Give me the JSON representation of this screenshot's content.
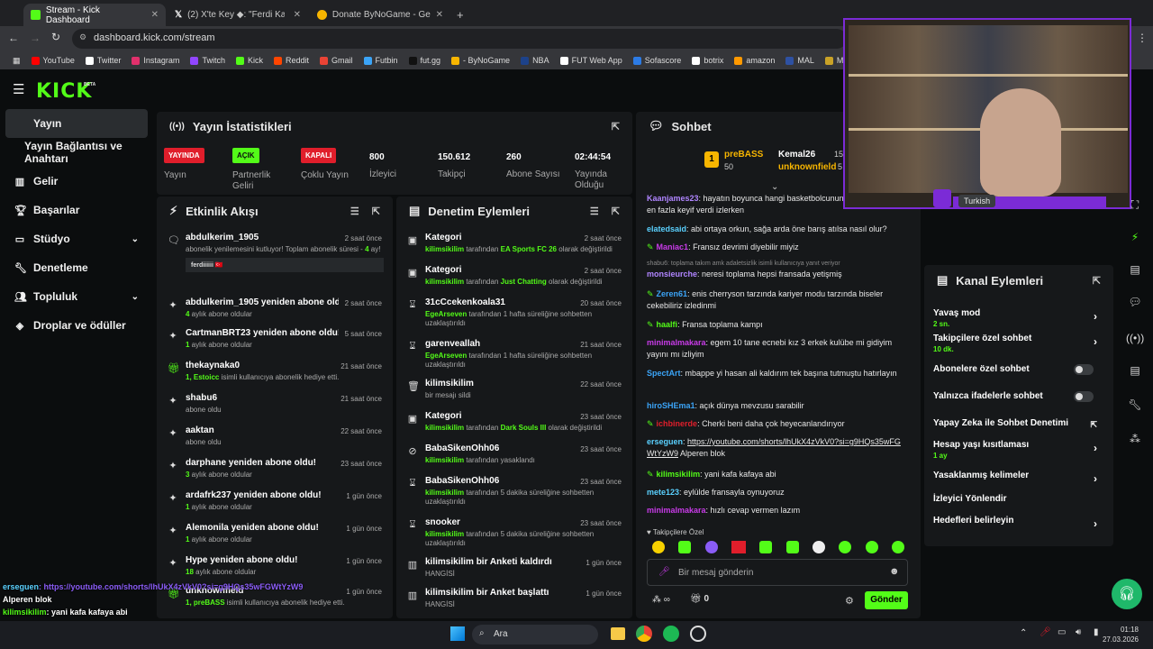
{
  "browser": {
    "tabs": [
      {
        "title": "Stream - Kick Dashboard",
        "active": true,
        "icon": "kick-favicon"
      },
      {
        "title": "(2) X'te Key ◆: \"Ferdi Kadıoğlu",
        "active": false,
        "icon": "x-favicon"
      },
      {
        "title": "Donate ByNoGame - Gelen/Gid",
        "active": false,
        "icon": "bynogame-favicon"
      }
    ],
    "url": "dashboard.kick.com/stream",
    "bookmarks": [
      {
        "label": "YouTube",
        "color": "#ff0000"
      },
      {
        "label": "Twitter",
        "color": "#ffffff"
      },
      {
        "label": "Instagram",
        "color": "#e1306c"
      },
      {
        "label": "Twitch",
        "color": "#9146ff"
      },
      {
        "label": "Kick",
        "color": "#53fc18"
      },
      {
        "label": "Reddit",
        "color": "#ff4500"
      },
      {
        "label": "Gmail",
        "color": "#ea4335"
      },
      {
        "label": "Futbin",
        "color": "#3ba4f7"
      },
      {
        "label": "fut.gg",
        "color": "#111111"
      },
      {
        "label": "- ByNoGame",
        "color": "#f7b500"
      },
      {
        "label": "NBA",
        "color": "#1d428a"
      },
      {
        "label": "FUT Web App",
        "color": "#ffffff"
      },
      {
        "label": "Sofascore",
        "color": "#2c7be5"
      },
      {
        "label": "botrix",
        "color": "#ffffff"
      },
      {
        "label": "amazon",
        "color": "#ff9900"
      },
      {
        "label": "MAL",
        "color": "#2e51a2"
      },
      {
        "label": "MetaTFT",
        "color": "#c9a227"
      }
    ]
  },
  "header": {
    "logo": "KICK",
    "beta": "BETA"
  },
  "sidebar": {
    "items": [
      {
        "label": "Yayın",
        "icon": "broadcast-icon"
      },
      {
        "label": "Yayın Bağlantısı ve Anahtarı",
        "icon": ""
      },
      {
        "label": "Gelir",
        "icon": "chart-icon"
      },
      {
        "label": "Başarılar",
        "icon": "trophy-icon"
      },
      {
        "label": "Stüdyo",
        "icon": "studio-icon"
      },
      {
        "label": "Denetleme",
        "icon": "wrench-icon"
      },
      {
        "label": "Topluluk",
        "icon": "community-icon"
      },
      {
        "label": "Droplar ve ödüller",
        "icon": "drops-icon"
      }
    ]
  },
  "stats": {
    "title": "Yayın İstatistikleri",
    "items": [
      {
        "badge": "YAYINDA",
        "badge_color": "#e01e2b",
        "label": "Yayın"
      },
      {
        "badge": "AÇIK",
        "badge_color": "#53fc18",
        "label": "Partnerlik Geliri"
      },
      {
        "badge": "KAPALI",
        "badge_color": "#e01e2b",
        "label": "Çoklu Yayın"
      },
      {
        "value": "800",
        "label": "İzleyici"
      },
      {
        "value": "150.612",
        "label": "Takipçi"
      },
      {
        "value": "260",
        "label": "Abone Sayısı"
      },
      {
        "value": "02:44:54",
        "label": "Yayında Olduğu"
      }
    ]
  },
  "activity": {
    "title": "Etkinlik Akışı",
    "rows": [
      {
        "title": "abdulkerim_1905",
        "time": "2 saat önce",
        "sub_pre": "abonelik yenilemesini kutluyor! Toplam abonelik süresi - ",
        "sub_hl": "4",
        "sub_post": " ay!",
        "quote": "ferdiiiiii 🇹🇷"
      },
      {
        "title": "abdulkerim_1905 yeniden abone oldu!",
        "time": "2 saat önce",
        "sub_hl": "4",
        "sub_post": " aylık abone oldular"
      },
      {
        "title": "CartmanBRT23 yeniden abone oldu!",
        "time": "5 saat önce",
        "sub_hl": "1",
        "sub_post": " aylık abone oldular"
      },
      {
        "title": "thekaynaka0",
        "time": "21 saat önce",
        "sub_hl": "1, Estoicc",
        "sub_post": " isimli kullanıcıya abonelik hediye etti."
      },
      {
        "title": "shabu6",
        "time": "21 saat önce",
        "sub_post": "abone oldu"
      },
      {
        "title": "aaktan",
        "time": "22 saat önce",
        "sub_post": "abone oldu"
      },
      {
        "title": "darphane yeniden abone oldu!",
        "time": "23 saat önce",
        "sub_hl": "3",
        "sub_post": " aylık abone oldular"
      },
      {
        "title": "ardafrk237 yeniden abone oldu!",
        "time": "1 gün önce",
        "sub_hl": "1",
        "sub_post": " aylık abone oldular"
      },
      {
        "title": "Alemonila yeniden abone oldu!",
        "time": "1 gün önce",
        "sub_hl": "1",
        "sub_post": " aylık abone oldular"
      },
      {
        "title": "Hype yeniden abone oldu!",
        "time": "1 gün önce",
        "sub_hl": "18",
        "sub_post": " aylık abone oldular"
      },
      {
        "title": "unknownfield",
        "time": "1 gün önce",
        "sub_hl": "1, preBASS",
        "sub_post": " isimli kullanıcıya abonelik hediye etti."
      }
    ]
  },
  "moderation": {
    "title": "Denetim Eylemleri",
    "rows": [
      {
        "title": "Kategori",
        "time": "2 saat önce",
        "icon": "category-icon",
        "who": "kilimsikilim",
        "mid": " tarafından ",
        "target": "EA Sports FC 26",
        "end": " olarak değiştirildi"
      },
      {
        "title": "Kategori",
        "time": "2 saat önce",
        "icon": "category-icon",
        "who": "kilimsikilim",
        "mid": " tarafından ",
        "target": "Just Chatting",
        "end": " olarak değiştirildi"
      },
      {
        "title": "31cCcekenkoala31",
        "time": "20 saat önce",
        "icon": "hourglass-icon",
        "who": "EgeArseven",
        "mid": " tarafından 1 hafta süreliğine sohbetten uzaklaştırıldı",
        "target": "",
        "end": ""
      },
      {
        "title": "garenveallah",
        "time": "21 saat önce",
        "icon": "hourglass-icon",
        "who": "EgeArseven",
        "mid": " tarafından 1 hafta süreliğine sohbetten uzaklaştırıldı",
        "target": "",
        "end": ""
      },
      {
        "title": "kilimsikilim",
        "time": "22 saat önce",
        "icon": "trash-icon",
        "who": "",
        "mid": "bir mesajı sildi",
        "target": "",
        "end": ""
      },
      {
        "title": "Kategori",
        "time": "23 saat önce",
        "icon": "category-icon",
        "who": "kilimsikilim",
        "mid": " tarafından ",
        "target": "Dark Souls III",
        "end": " olarak değiştirildi"
      },
      {
        "title": "BabaSikenOhh06",
        "time": "23 saat önce",
        "icon": "ban-icon",
        "who": "kilimsikilim",
        "mid": " tarafından yasaklandı",
        "target": "",
        "end": ""
      },
      {
        "title": "BabaSikenOhh06",
        "time": "23 saat önce",
        "icon": "hourglass-icon",
        "who": "kilimsikilim",
        "mid": " tarafından 5 dakika süreliğine sohbetten uzaklaştırıldı",
        "target": "",
        "end": ""
      },
      {
        "title": "snooker",
        "time": "23 saat önce",
        "icon": "hourglass-icon",
        "who": "kilimsikilim",
        "mid": " tarafından 5 dakika süreliğine sohbetten uzaklaştırıldı",
        "target": "",
        "end": ""
      },
      {
        "title": "kilimsikilim bir Anketi kaldırdı",
        "time": "1 gün önce",
        "icon": "poll-icon",
        "who": "",
        "mid": "HANGİSİ",
        "target": "",
        "end": ""
      },
      {
        "title": "kilimsikilim bir Anket başlattı",
        "time": "1 gün önce",
        "icon": "poll-icon",
        "who": "",
        "mid": "HANGİSİ",
        "target": "",
        "end": ""
      }
    ]
  },
  "chat": {
    "title": "Sohbet",
    "leaderboard": [
      {
        "rank": "1",
        "name": "preBASS",
        "count": "50"
      },
      {
        "name": "Kemal26",
        "count": "15"
      },
      {
        "name": "unknownfield",
        "count": "5"
      }
    ],
    "messages": [
      {
        "user": "Kaanjames23",
        "color": "#b085ff",
        "text": ": hayatın boyunca hangi basketbolcunun hangi yılı sana en fazla keyif verdi izlerken"
      },
      {
        "user": "elatedsaid",
        "color": "#5ad1ff",
        "text": ": abi ortaya orkun, sağa arda öne barış atılsa nasıl olur?"
      },
      {
        "user": "Maniac1",
        "color": "#c83be8",
        "text": ": Fransız devrimi diyebilir miyiz",
        "badge": true
      },
      {
        "reply": "shabu6: toplama takım amk adaletsizlik isimli kullanıcıya yanıt veriyor",
        "user": "monsieurche",
        "color": "#b085ff",
        "text": ": neresi toplama hepsi fransada yetişmiş"
      },
      {
        "user": "Zeren61",
        "color": "#3ba4f7",
        "text": ": enis cherryson tarzında kariyer modu tarzında biseler cekebiliriz izledinmi",
        "badge": true
      },
      {
        "user": "haalfi",
        "color": "#53fc18",
        "text": ": Fransa toplama kampı",
        "badge": true
      },
      {
        "user": "minimalmakara",
        "color": "#c83be8",
        "text": ": egem 10 tane ecnebi kız 3 erkek kulübe mi gidiyim yayını mı izliyim"
      },
      {
        "user": "SpectArt",
        "color": "#3ba4f7",
        "text": ": mbappe yi hasan ali kaldırım tek başına tutmuştu hatırlayın"
      },
      {
        "user": "hiroSHEma1",
        "color": "#3ba4f7",
        "text": ": açık dünya mevzusu sarabilir"
      },
      {
        "user": "ichbinerde",
        "color": "#e01e2b",
        "text": ": Cherki beni daha çok heyecanlandırıyor",
        "badge": true
      },
      {
        "user": "erseguen",
        "color": "#5ad1ff",
        "text": ": ",
        "link": "https://youtube.com/shorts/lhUkX4zVkV0?si=g9HQs35wFGWtYzW9",
        "after": " Alperen blok"
      },
      {
        "user": "kilimsikilim",
        "color": "#53fc18",
        "text": ": yani kafa kafaya abi",
        "badge": true
      },
      {
        "user": "mete123",
        "color": "#5ad1ff",
        "text": ": eylülde fransayla oynuyoruz"
      },
      {
        "user": "minimalmakara",
        "color": "#c83be8",
        "text": ": hızlı cevap vermen lazım"
      }
    ],
    "mode_label": "Takipçilere Özel",
    "input_placeholder": "Bir mesaj gönderin",
    "points": "0",
    "send_label": "Gönder"
  },
  "streamer_overlay": {
    "language_tag": "Turkish"
  },
  "channel_actions": {
    "title": "Kanal Eylemleri",
    "items": [
      {
        "label": "Yavaş mod",
        "sub": "2 sn.",
        "kind": "arrow"
      },
      {
        "label": "Takipçilere özel sohbet",
        "sub": "10 dk.",
        "kind": "arrow"
      },
      {
        "label": "Abonelere özel sohbet",
        "kind": "toggle"
      },
      {
        "label": "Yalnızca ifadelerle sohbet",
        "kind": "toggle"
      },
      {
        "label": "Yapay Zeka ile Sohbet Denetimi",
        "kind": "external"
      },
      {
        "label": "Hesap yaşı kısıtlaması",
        "sub": "1 ay",
        "kind": "arrow"
      },
      {
        "label": "Yasaklanmış kelimeler",
        "kind": "arrow"
      },
      {
        "label": "İzleyici Yönlendir",
        "kind": "none"
      },
      {
        "label": "Hedefleri belirleyin",
        "kind": "arrow"
      }
    ]
  },
  "overlay_chat": [
    {
      "user": "erseguen",
      "text": ": https://youtube.com/shorts/lhUkX4zVkV0?si=g9HQs35wFGWtYzW9"
    },
    {
      "user": "",
      "text": "Alperen blok"
    },
    {
      "user": "kilimsikilim",
      "text": ": yani kafa kafaya abi"
    },
    {
      "user": "mete123",
      "text": ": eylülde fransayla oynuyoruz"
    },
    {
      "user": "minimalmakara",
      "text": ": hızlı cevap vermen lazım"
    }
  ],
  "taskbar": {
    "search": "Ara",
    "time": "01:18",
    "date": "27.03.2026"
  }
}
